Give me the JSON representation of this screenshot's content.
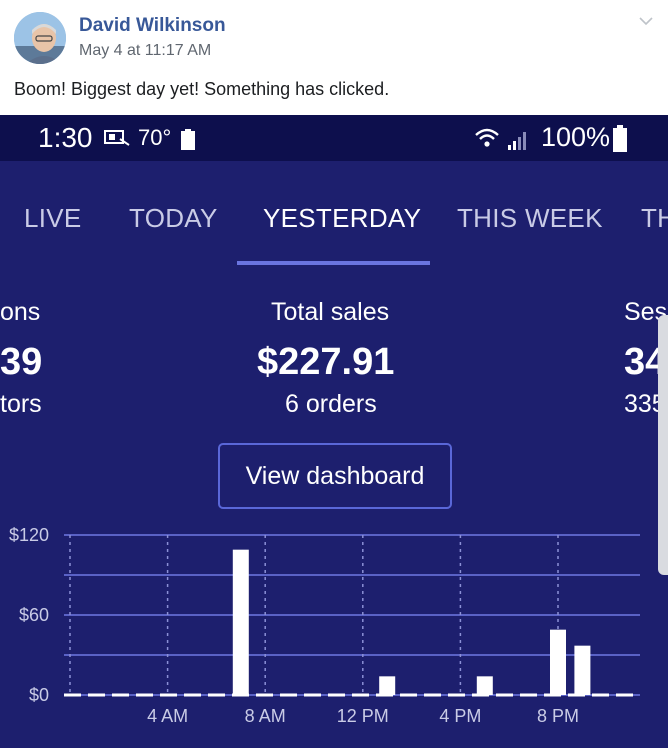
{
  "post": {
    "author": "David Wilkinson",
    "timestamp": "May 4 at 11:17 AM",
    "text": "Boom! Biggest day yet! Something has clicked."
  },
  "phone": {
    "time": "1:30",
    "temperature": "70°",
    "battery": "100%",
    "tabs": [
      "LIVE",
      "TODAY",
      "YESTERDAY",
      "THIS WEEK",
      "TH"
    ],
    "active_tab": "YESTERDAY",
    "metrics": {
      "left": {
        "label": "ons",
        "value": "39",
        "sub": "tors"
      },
      "center": {
        "label": "Total sales",
        "value": "$227.91",
        "sub": "6 orders"
      },
      "right": {
        "label": "Ses",
        "value": "34",
        "sub": "335"
      }
    },
    "button_label": "View dashboard"
  },
  "colors": {
    "background": "#1d1f6e",
    "statusbar": "#0d0f4d",
    "accent": "#5a67d8",
    "author": "#385898"
  },
  "chart_data": {
    "type": "bar",
    "y_ticks": [
      "$120",
      "$60",
      "$0"
    ],
    "x_ticks": [
      "4 AM",
      "8 AM",
      "12 PM",
      "4 PM",
      "8 PM"
    ],
    "ylim": [
      0,
      120
    ],
    "hours": [
      7,
      13,
      17,
      20,
      21
    ],
    "values": [
      109,
      14,
      14,
      49,
      37
    ]
  }
}
